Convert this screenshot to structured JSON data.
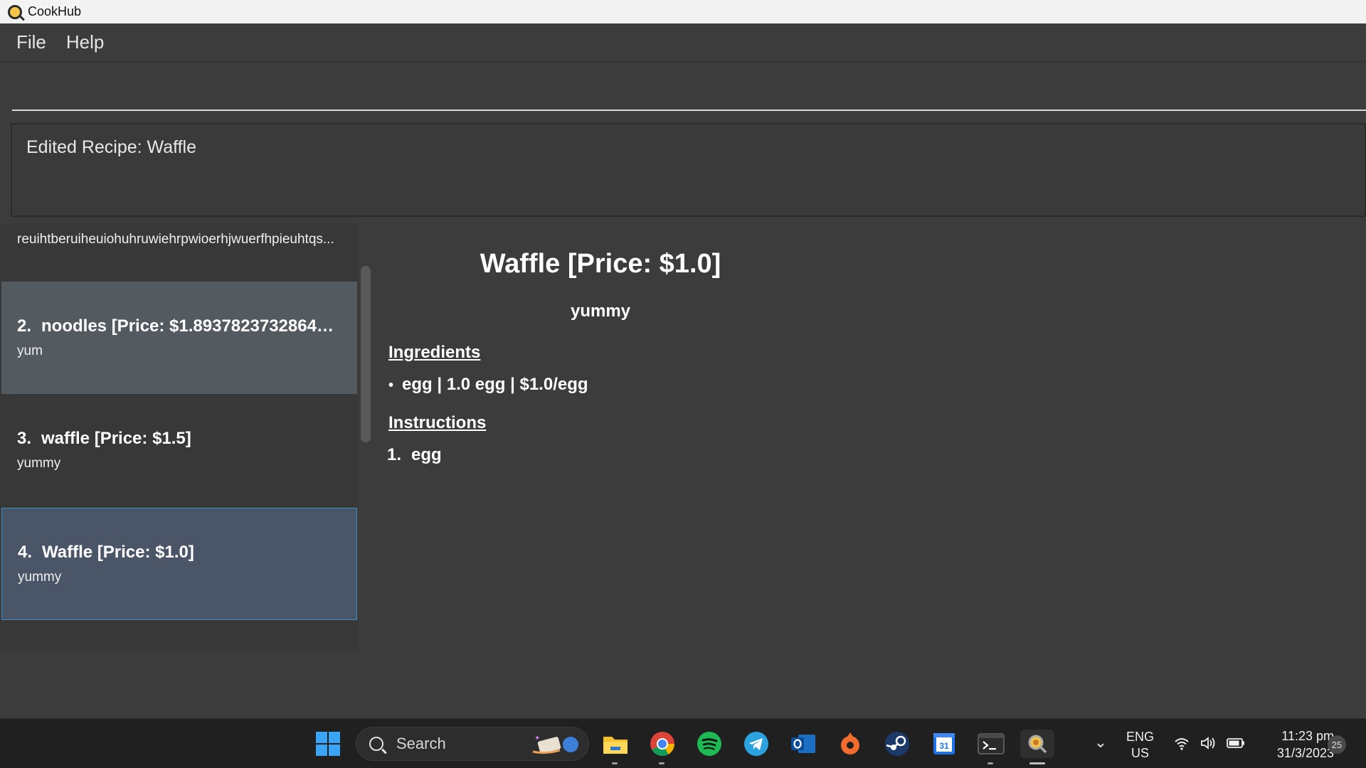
{
  "window": {
    "title": "CookHub"
  },
  "menu": {
    "file": "File",
    "help": "Help"
  },
  "command": {
    "value": ""
  },
  "result": {
    "text": "Edited Recipe: Waffle"
  },
  "recipes": {
    "partial_desc": "reuihtberuiheuiohuhruwiehrpwioerhjwuerfhpieuhtqs...",
    "items": [
      {
        "index": "2.",
        "title": "noodles [Price: $1.893782373286429E...",
        "desc": "yum"
      },
      {
        "index": "3.",
        "title": "waffle [Price: $1.5]",
        "desc": "yummy"
      },
      {
        "index": "4.",
        "title": "Waffle [Price: $1.0]",
        "desc": "yummy"
      }
    ]
  },
  "detail": {
    "title": "Waffle [Price: $1.0]",
    "desc": "yummy",
    "ingredients_heading": "Ingredients",
    "ingredients": [
      "egg | 1.0 egg | $1.0/egg"
    ],
    "instructions_heading": "Instructions",
    "instructions": [
      {
        "num": "1.",
        "text": "egg"
      }
    ]
  },
  "taskbar": {
    "search_label": "Search",
    "lang_top": "ENG",
    "lang_bottom": "US",
    "time": "11:23 pm",
    "date": "31/3/2023",
    "notifications": "25",
    "calendar_day": "31",
    "colors": {
      "accent_blue": "#3aa4f5",
      "spotify": "#1db954",
      "telegram": "#2aa3e0",
      "origin": "#f26c2d"
    }
  }
}
